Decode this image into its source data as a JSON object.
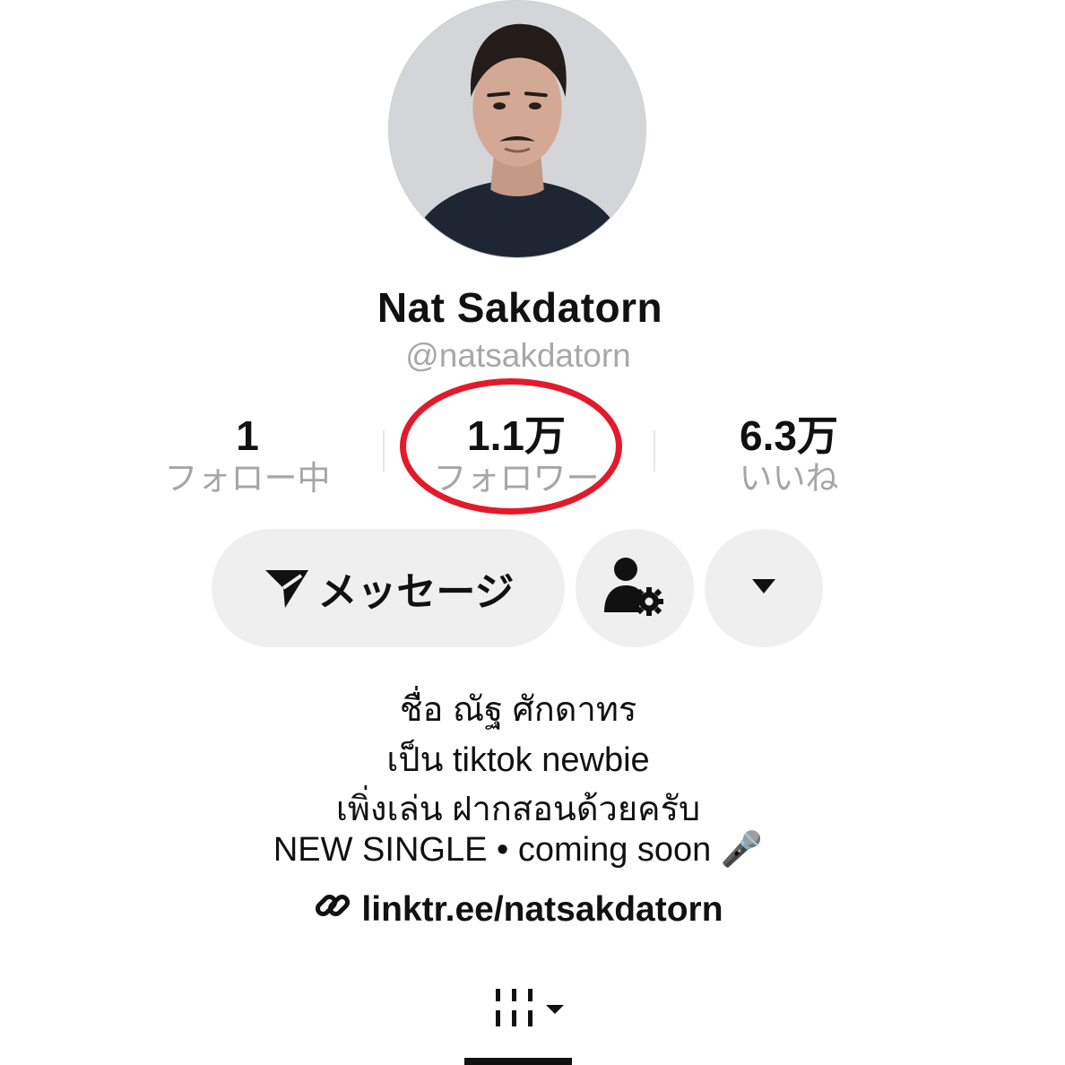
{
  "profile": {
    "display_name": "Nat Sakdatorn",
    "handle": "@natsakdatorn"
  },
  "stats": {
    "following": {
      "value": "1",
      "label": "フォロー中"
    },
    "followers": {
      "value": "1.1万",
      "label": "フォロワー"
    },
    "likes": {
      "value": "6.3万",
      "label": "いいね"
    }
  },
  "actions": {
    "message_label": "メッセージ"
  },
  "bio": {
    "line1": "ชื่อ ณัฐ ศักดาทร",
    "line2": "เป็น tiktok newbie",
    "line3": "เพิ่งเล่น ฝากสอนด้วยครับ",
    "line4": "NEW SINGLE • coming soon 🎤",
    "link": "linktr.ee/natsakdatorn"
  },
  "icons": {
    "message": "send-icon",
    "user_settings": "user-gear-icon",
    "more": "caret-down-icon",
    "link": "link-icon",
    "videos_tab": "grid-icon"
  },
  "colors": {
    "highlight": "#e31a2b",
    "button_bg": "#efefef",
    "secondary_text": "#a6a6a6"
  }
}
